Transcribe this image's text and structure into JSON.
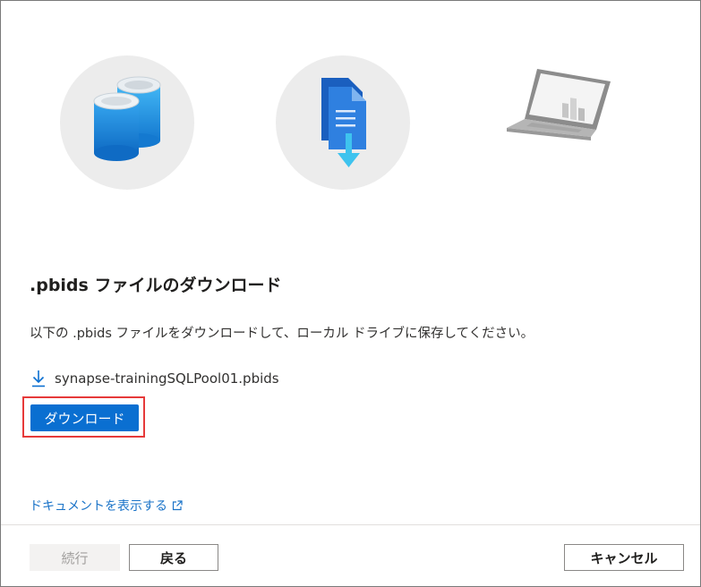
{
  "illustrations": {
    "database_icon": "database-icon",
    "file_download_icon": "file-download-icon",
    "laptop_icon": "laptop-icon"
  },
  "dialog": {
    "title": ".pbids ファイルのダウンロード",
    "description": "以下の .pbids ファイルをダウンロードして、ローカル ドライブに保存してください。",
    "file_name": "synapse-trainingSQLPool01.pbids",
    "download_button": "ダウンロード",
    "docs_link": "ドキュメントを表示する"
  },
  "footer": {
    "continue_button": "続行",
    "back_button": "戻る",
    "cancel_button": "キャンセル"
  },
  "colors": {
    "accent": "#0a6fd1",
    "highlight": "#e63a3a",
    "link": "#1a73c8"
  }
}
